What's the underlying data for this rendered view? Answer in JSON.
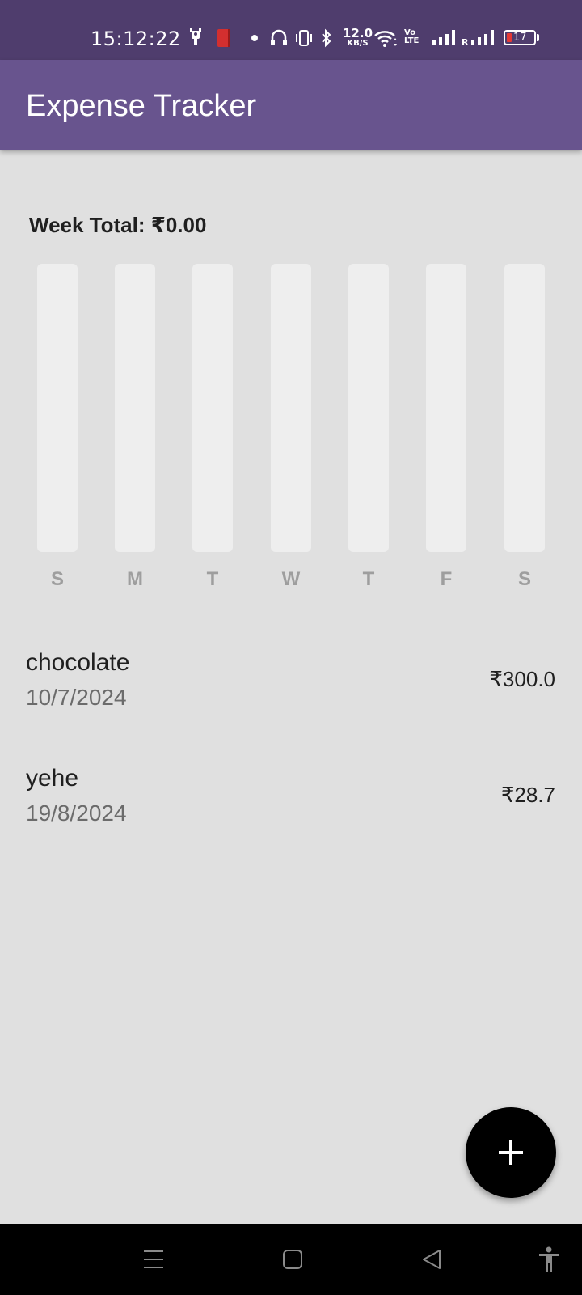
{
  "status_bar": {
    "time": "15:12:22",
    "net_speed_value": "12.0",
    "net_speed_unit": "KB/S",
    "volte_top": "Vo",
    "volte_bottom": "LTE",
    "roaming_label": "R",
    "battery_level": "17",
    "icons": [
      "notification-app-icon",
      "red-app-icon",
      "dot-icon",
      "headphones-icon",
      "vibrate-icon",
      "bluetooth-icon",
      "wifi-icon",
      "signal-icon",
      "signal-roaming-icon",
      "battery-icon"
    ]
  },
  "app_bar": {
    "title": "Expense Tracker",
    "color": "#68548e"
  },
  "chart_data": {
    "type": "bar",
    "title": "Week Total: ₹0.00",
    "categories": [
      "S",
      "M",
      "T",
      "W",
      "T",
      "F",
      "S"
    ],
    "values": [
      0,
      0,
      0,
      0,
      0,
      0,
      0
    ],
    "ylim": [
      0,
      1
    ]
  },
  "expenses": [
    {
      "title": "chocolate",
      "date": "10/7/2024",
      "amount": "₹300.0"
    },
    {
      "title": "yehe",
      "date": "19/8/2024",
      "amount": "₹28.7"
    }
  ],
  "fab": {
    "icon": "plus-icon"
  },
  "nav_bar": {
    "icons": [
      "menu-icon",
      "home-icon",
      "back-icon",
      "accessibility-icon"
    ]
  }
}
